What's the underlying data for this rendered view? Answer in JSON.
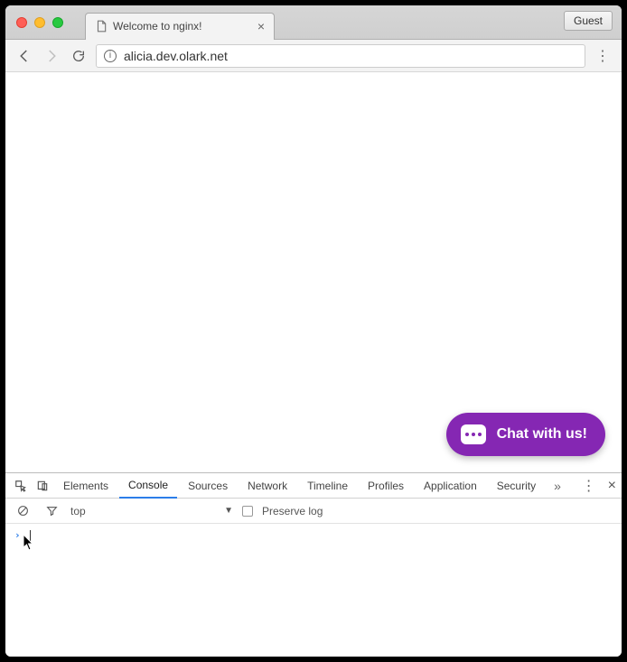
{
  "browser": {
    "tab_title": "Welcome to nginx!",
    "guest_label": "Guest",
    "url": "alicia.dev.olark.net"
  },
  "chat": {
    "label": "Chat with us!"
  },
  "devtools": {
    "tabs": [
      "Elements",
      "Console",
      "Sources",
      "Network",
      "Timeline",
      "Profiles",
      "Application",
      "Security"
    ],
    "active_tab": "Console",
    "context_selector": "top",
    "preserve_log_label": "Preserve log"
  }
}
